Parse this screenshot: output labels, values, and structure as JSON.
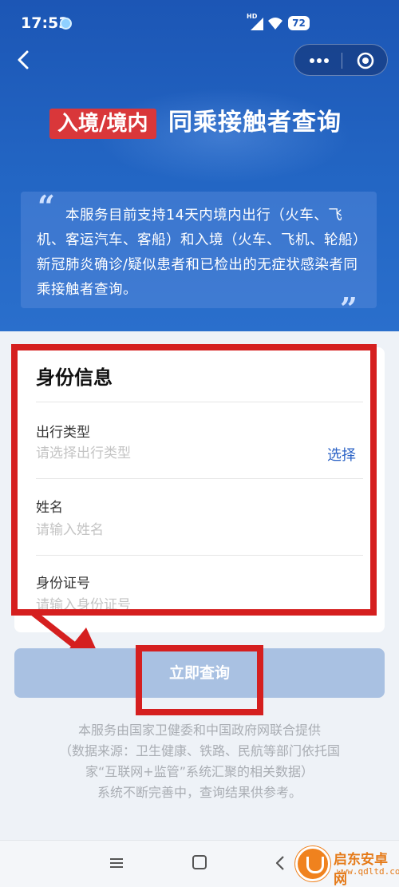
{
  "status_bar": {
    "time": "17:53",
    "network": "HD",
    "battery": "72"
  },
  "header": {
    "badge": "入境/境内",
    "title": "同乘接触者查询"
  },
  "notice": {
    "text": "本服务目前支持14天内境内出行（火车、飞机、客运汽车、客船）和入境（火车、飞机、轮船）新冠肺炎确诊/疑似患者和已检出的无症状感染者同乘接触者查询。",
    "open_quote": "“",
    "close_quote": "”"
  },
  "form": {
    "title": "身份信息",
    "travel_type": {
      "label": "出行类型",
      "placeholder": "请选择出行类型",
      "action": "选择"
    },
    "name": {
      "label": "姓名",
      "placeholder": "请输入姓名"
    },
    "id_number": {
      "label": "身份证号",
      "placeholder": "请输入身份证号"
    }
  },
  "query_button": "立即查询",
  "footer": {
    "lines": [
      "本服务由国家卫健委和中国政府网联合提供",
      "（数据来源：卫生健康、铁路、民航等部门依托国",
      "家“互联网+监管”系统汇聚的相关数据）",
      "系统不断完善中，查询结果供参考。"
    ]
  },
  "watermark": {
    "name": "启东安卓网",
    "url": "www.qdltd.com"
  },
  "colors": {
    "header_bg": "#2366c4",
    "badge_bg": "#d9373a",
    "highlight_red": "#d51f1f",
    "link_blue": "#2c63c6",
    "button_disabled": "#a9c1e2"
  },
  "icons": {
    "back": "chevron-left-icon",
    "more": "more-dots-icon",
    "close": "target-close-icon",
    "nav_menu": "menu-icon",
    "nav_home": "home-square-icon",
    "nav_back": "back-triangle-icon"
  }
}
